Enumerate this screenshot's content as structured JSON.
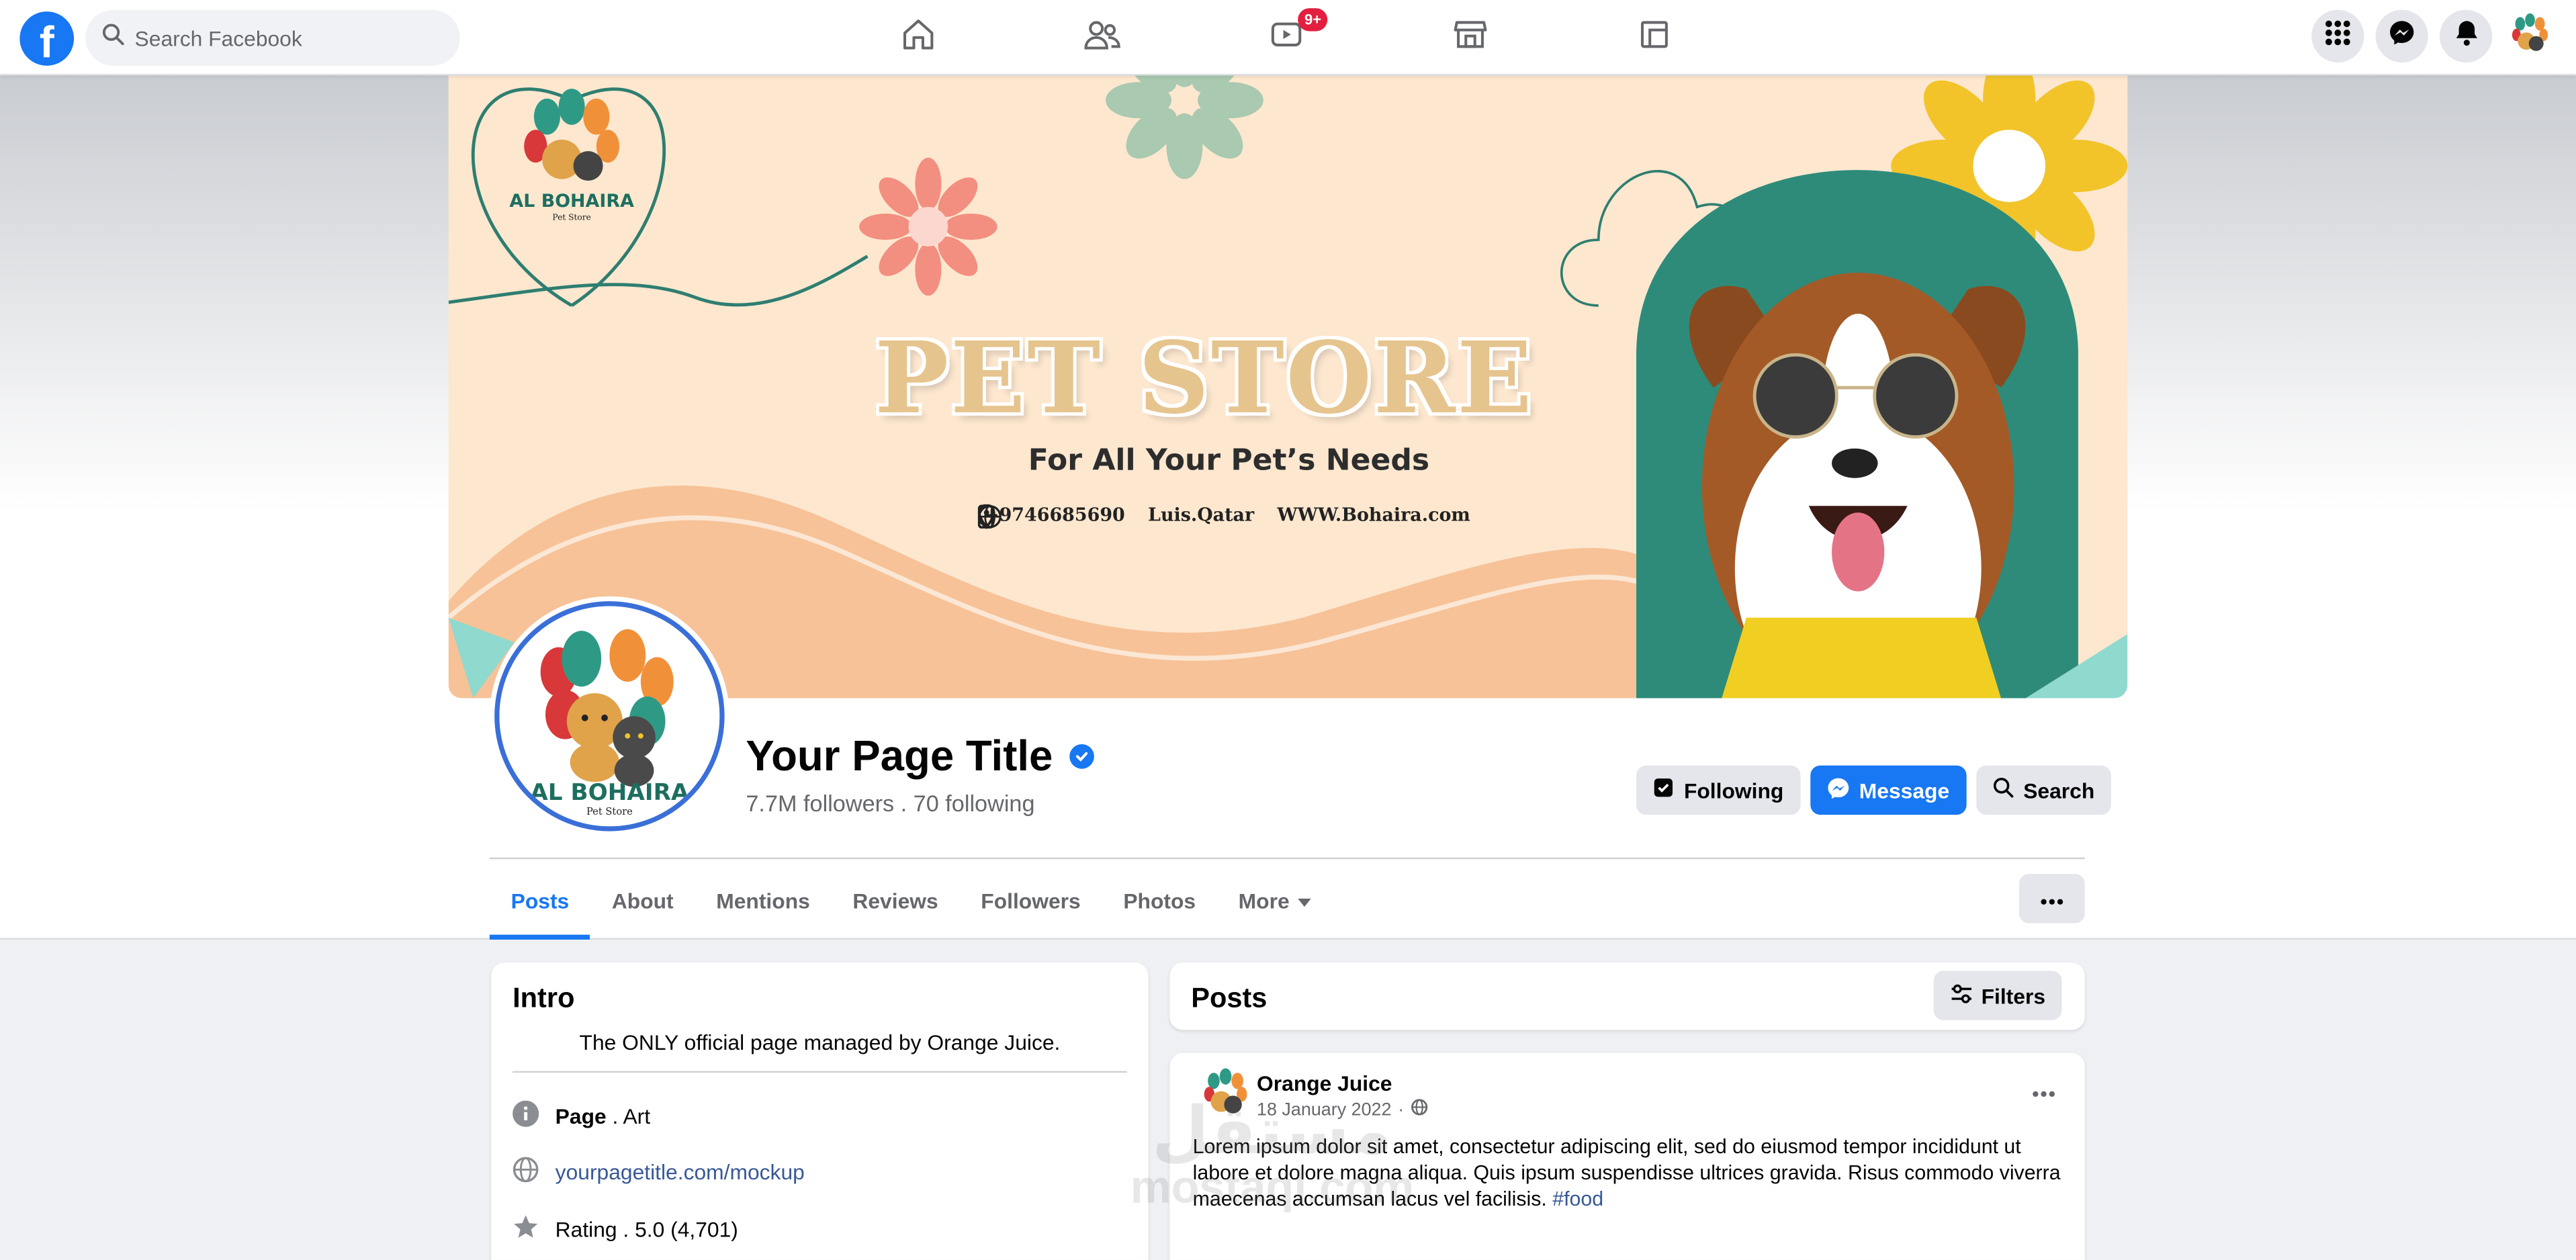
{
  "nav": {
    "logo": "f",
    "search_placeholder": "Search Facebook",
    "watch_badge": "9+",
    "tabs": [
      "home-icon",
      "friends-icon",
      "watch-icon",
      "marketplace-icon",
      "gaming-icon"
    ],
    "right_icons": [
      "menu-grid-icon",
      "messenger-icon",
      "notifications-icon",
      "account-avatar"
    ]
  },
  "cover": {
    "logo_text": "AL BOHAIRA",
    "logo_sub": "Pet Store",
    "title": "PET STORE",
    "subtitle": "For All Your Pet’s Needs",
    "phone": "+9746685690",
    "location": "Luis.Qatar",
    "website": "WWW.Bohaira.com"
  },
  "profile": {
    "title": "Your Page Title",
    "stats": "7.7M followers . 70 following",
    "logo_text": "AL BOHAIRA",
    "logo_sub": "Pet Store"
  },
  "actions": {
    "following": "Following",
    "message": "Message",
    "search": "Search"
  },
  "tabs": [
    "Posts",
    "About",
    "Mentions",
    "Reviews",
    "Followers",
    "Photos",
    "More"
  ],
  "intro": {
    "heading": "Intro",
    "bio": "The ONLY official page managed by Orange Juice.",
    "category_label": "Page",
    "category_value": " . Art",
    "website": "yourpagetitle.com/mockup",
    "rating": "Rating . 5.0 (4,701)"
  },
  "posts": {
    "heading": "Posts",
    "filters": "Filters",
    "post": {
      "author": "Orange Juice",
      "date": "18 January 2022",
      "date_sep": "·",
      "text": "Lorem ipsum dolor sit amet, consectetur adipiscing elit, sed do eiusmod tempor incididunt ut labore et dolore magna aliqua. Quis ipsum suspendisse ultrices gravida. Risus commodo viverra maecenas accumsan lacus vel facilisis. ",
      "hashtag": "#food"
    }
  },
  "watermark": {
    "line1": "مستقل",
    "line2": "mostaql.com"
  },
  "colors": {
    "brand": "#1877f2",
    "cover_bg": "#fde7cf",
    "teal": "#2e8b7a",
    "title_tan": "#e6c48e"
  }
}
